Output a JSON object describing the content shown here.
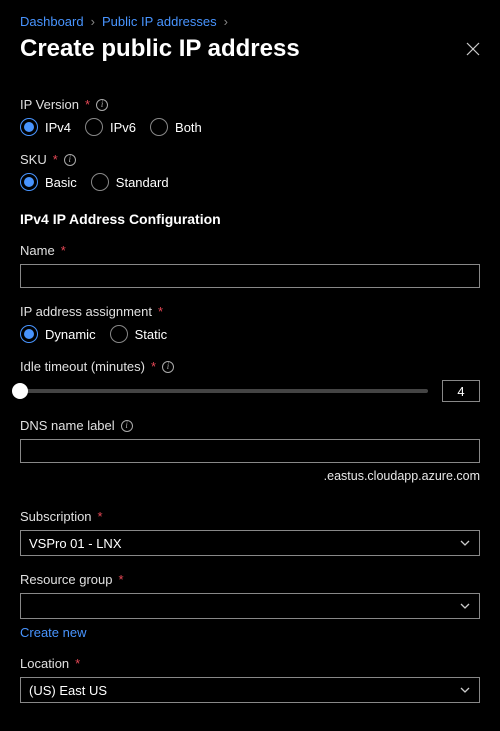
{
  "breadcrumb": {
    "dashboard": "Dashboard",
    "publicIps": "Public IP addresses"
  },
  "title": "Create public IP address",
  "ipVersion": {
    "label": "IP Version",
    "options": {
      "ipv4": "IPv4",
      "ipv6": "IPv6",
      "both": "Both"
    },
    "selected": "ipv4"
  },
  "sku": {
    "label": "SKU",
    "options": {
      "basic": "Basic",
      "standard": "Standard"
    },
    "selected": "basic"
  },
  "ipv4Section": "IPv4 IP Address Configuration",
  "nameLabel": "Name",
  "nameValue": "",
  "assignment": {
    "label": "IP address assignment",
    "options": {
      "dynamic": "Dynamic",
      "static": "Static"
    },
    "selected": "dynamic"
  },
  "idleTimeout": {
    "label": "Idle timeout (minutes)",
    "value": "4"
  },
  "dns": {
    "label": "DNS name label",
    "value": "",
    "suffix": ".eastus.cloudapp.azure.com"
  },
  "subscription": {
    "label": "Subscription",
    "value": "VSPro 01 - LNX"
  },
  "resourceGroup": {
    "label": "Resource group",
    "value": "",
    "createNew": "Create new"
  },
  "location": {
    "label": "Location",
    "value": "(US) East US"
  }
}
